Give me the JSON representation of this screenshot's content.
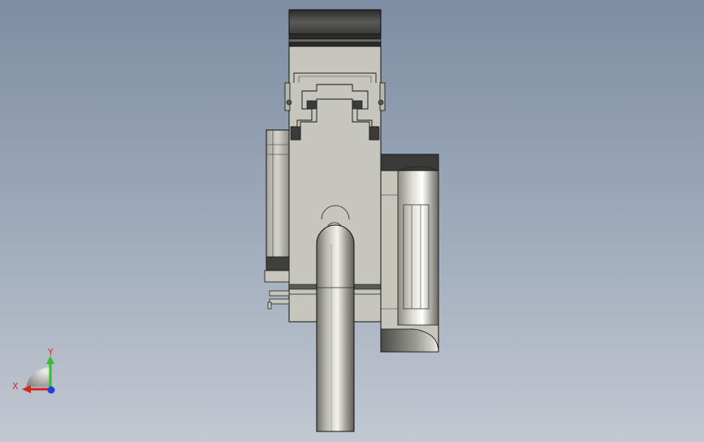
{
  "viewport": {
    "background_top": "#7f8da3",
    "background_bottom": "#c2c8d1"
  },
  "model": {
    "body_color": "#c6c6bd",
    "dark_color": "#3a3a3a",
    "edge_color": "#1a1a1a"
  },
  "triad": {
    "x_label": "X",
    "y_label": "Y",
    "x_color": "#e02020",
    "y_color": "#2ec02e",
    "z_color": "#2040e0"
  }
}
